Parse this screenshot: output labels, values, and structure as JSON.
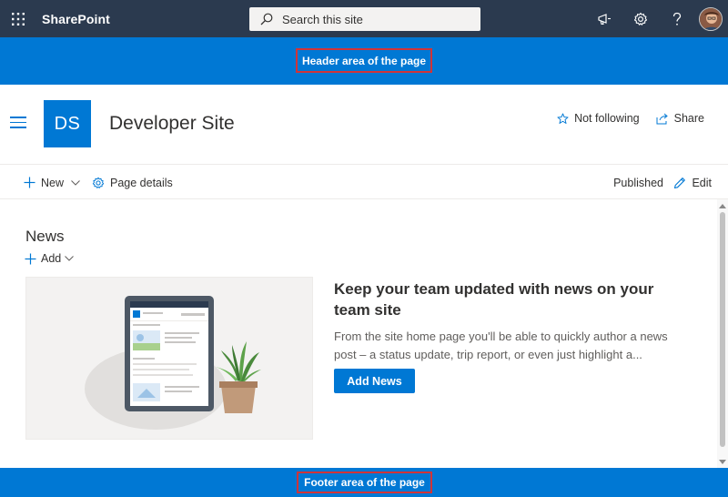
{
  "suite_bar": {
    "app_name": "SharePoint",
    "search_placeholder": "Search this site",
    "icons": [
      "waffle-icon",
      "megaphone-icon",
      "gear-icon",
      "help-icon",
      "avatar"
    ]
  },
  "header_callout": "Header area of the page",
  "footer_callout": "Footer area of the page",
  "site_header": {
    "logo_initials": "DS",
    "title": "Developer Site",
    "follow_label": "Not following",
    "share_label": "Share"
  },
  "command_bar": {
    "new_label": "New",
    "page_details_label": "Page details",
    "status": "Published",
    "edit_label": "Edit"
  },
  "news": {
    "title": "News",
    "add_label": "Add",
    "promo_title": "Keep your team updated with news on your team site",
    "promo_description": "From the site home page you'll be able to quickly author a news post – a status update, trip report, or even just highlight a...",
    "add_news_button": "Add News"
  },
  "colors": {
    "suite_bar": "#2b3a4f",
    "brand_blue": "#0078d4",
    "callout_border": "#d13438"
  }
}
